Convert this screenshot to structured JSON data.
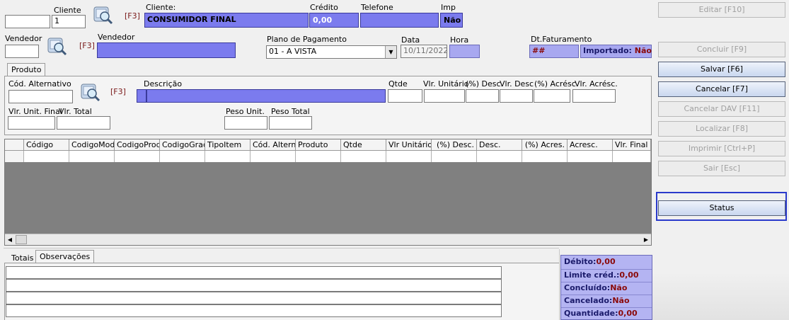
{
  "header": {
    "cliente_label": "Cliente",
    "cliente_code": "",
    "cliente_num": "1",
    "f3": "[F3]",
    "cliente_name_label": "Cliente:",
    "cliente_name": "CONSUMIDOR FINAL",
    "credito_label": "Crédito",
    "credito_value": "0,00",
    "telefone_label": "Telefone",
    "telefone_value": "",
    "imp_label": "Imp",
    "imp_value": "Não",
    "vendedor_label": "Vendedor",
    "vendedor_code": "",
    "vendedor_name_label": "Vendedor",
    "vendedor_name": "",
    "plano_label": "Plano de Pagamento",
    "plano_value": "01 - A VISTA",
    "data_label": "Data",
    "data_value": "10/11/2022",
    "hora_label": "Hora",
    "hora_value": "",
    "dtfat_label": "Dt.Faturamento",
    "dtfat_value": "##",
    "importado_label": "Importado:",
    "importado_value": "Não"
  },
  "produto": {
    "tab": "Produto",
    "cod_alt_label": "Cód. Alternativo",
    "f3": "[F3]",
    "descricao_label": "Descrição",
    "qtde_label": "Qtde",
    "vlr_unit_label": "Vlr. Unitário",
    "pct_desc_label": "(%) Desc.",
    "vlr_desc_label": "Vlr. Desc",
    "pct_acresc_label": "(%) Acrésc",
    "vlr_acresc_label": "Vlr. Acrésc.",
    "vlr_unit_final_label": "Vlr. Unit. Final",
    "vlr_total_label": "Vlr. Total",
    "peso_unit_label": "Peso Unit.",
    "peso_total_label": "Peso Total"
  },
  "grid": {
    "columns": [
      "Código",
      "CodigoModel",
      "CodigoProdu",
      "CodigoGrade",
      "TipoItem",
      "Cód. Alternat",
      "Produto",
      "Qtde",
      "Vlr Unitário",
      "(%) Desc.",
      "Desc.",
      "(%) Acres.",
      "Acresc.",
      "Vlr. Final"
    ]
  },
  "bottom": {
    "tab_totais": "Totais",
    "tab_obs": "Observações"
  },
  "status": {
    "debito_label": "Débito:",
    "debito_value": "0,00",
    "limite_label": "Limite créd.:",
    "limite_value": "0,00",
    "concluido_label": "Concluído:",
    "concluido_value": "Não",
    "cancelado_label": "Cancelado:",
    "cancelado_value": "Não",
    "quantidade_label": "Quantidade:",
    "quantidade_value": "0,00"
  },
  "buttons": {
    "editar": "Editar [F10]",
    "concluir": "Concluir [F9]",
    "salvar": "Salvar [F6]",
    "cancelar": "Cancelar [F7]",
    "cancelar_dav": "Cancelar DAV [F11]",
    "localizar": "Localizar [F8]",
    "imprimir": "Imprimir [Ctrl+P]",
    "sair": "Sair [Esc]",
    "status": "Status"
  },
  "colors": {
    "highlight": "#7b7bee",
    "status_panel": "#b4b4f2",
    "value_red": "#8a0a0a",
    "grid_empty": "#808080",
    "focus_border": "#2a3acb"
  }
}
